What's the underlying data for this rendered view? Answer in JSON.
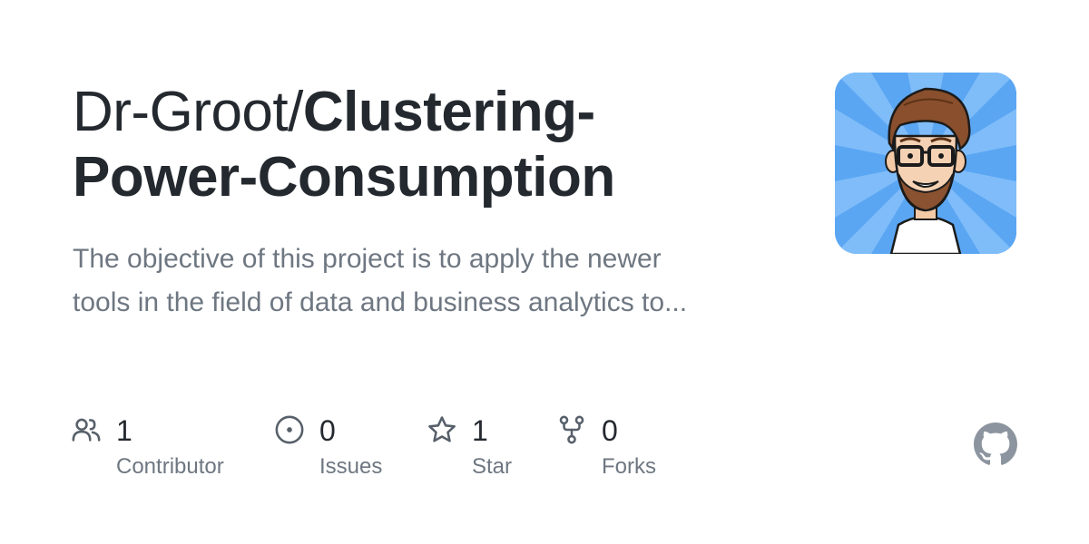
{
  "repo": {
    "owner": "Dr-Groot/",
    "name_line1": "Clustering-",
    "name_line2": "Power-Consumption",
    "description_line1": "The objective of this project is to apply the newer",
    "description_line2": "tools in the field of data and business analytics to..."
  },
  "avatar": {
    "icon": "cartoon-avatar-icon",
    "background_color": "#5aa6f3"
  },
  "stats": [
    {
      "icon": "people-icon",
      "count": "1",
      "label": "Contributor"
    },
    {
      "icon": "issue-opened-icon",
      "count": "0",
      "label": "Issues"
    },
    {
      "icon": "star-icon",
      "count": "1",
      "label": "Star"
    },
    {
      "icon": "fork-icon",
      "count": "0",
      "label": "Forks"
    }
  ],
  "branding": {
    "logo_icon": "github-logo-icon"
  },
  "colors": {
    "title": "#24292f",
    "muted": "#6e7781",
    "icon": "#57606a",
    "logo": "#8c959f"
  }
}
